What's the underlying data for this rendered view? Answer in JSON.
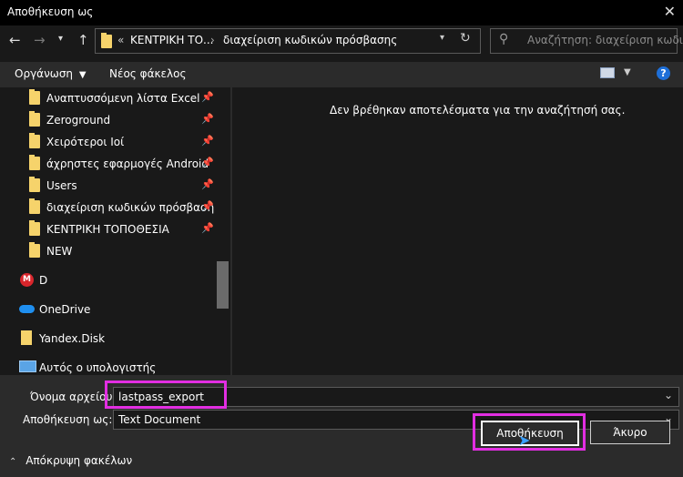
{
  "window": {
    "title": "Αποθήκευση ως"
  },
  "nav": {
    "breadcrumb_sep": "«",
    "crumb1": "ΚΕΝΤΡΙΚΗ ΤΟ...",
    "crumb2": "διαχείριση κωδικών πρόσβασης",
    "search_placeholder": "Αναζήτηση: διαχείριση κωδι..."
  },
  "toolbar": {
    "organize": "Οργάνωση",
    "new_folder": "Νέος φάκελος"
  },
  "sidebar": {
    "items": [
      {
        "label": "Αναπτυσσόμενη λίστα Excel",
        "icon": "folder-icon",
        "pinned": true
      },
      {
        "label": "Zeroground",
        "icon": "folder-icon",
        "pinned": true
      },
      {
        "label": "Χειρότεροι Ιοί",
        "icon": "folder-icon",
        "pinned": true
      },
      {
        "label": "άχρηστες εφαρμογές Android",
        "icon": "folder-icon",
        "pinned": true
      },
      {
        "label": "Users",
        "icon": "folder-icon",
        "pinned": true
      },
      {
        "label": "διαχείριση κωδικών πρόσβαση",
        "icon": "folder-icon",
        "pinned": true
      },
      {
        "label": "ΚΕΝΤΡΙΚΗ ΤΟΠΟΘΕΣΙΑ",
        "icon": "folder-icon",
        "pinned": true
      },
      {
        "label": "NEW",
        "icon": "folder-icon",
        "pinned": false
      }
    ],
    "drives": [
      {
        "label": "D",
        "icon": "mega-icon"
      },
      {
        "label": "OneDrive",
        "icon": "cloud-icon"
      },
      {
        "label": "Yandex.Disk",
        "icon": "yandex-disk-icon"
      },
      {
        "label": "Αυτός ο υπολογιστής",
        "icon": "computer-icon"
      }
    ]
  },
  "main": {
    "empty_message": "Δεν βρέθηκαν αποτελέσματα για την αναζήτησή σας."
  },
  "form": {
    "filename_label": "Όνομα αρχείου:",
    "filename_value": "lastpass_export",
    "savetype_label": "Αποθήκευση ως:",
    "savetype_value": "Text Document"
  },
  "footer": {
    "hide_folders": "Απόκρυψη φακέλων",
    "save_button": "Αποθήκευση",
    "cancel_button": "Άκυρο"
  },
  "colors": {
    "highlight": "#e22ee2",
    "folder": "#f6d36b",
    "help": "#1e6fd8"
  }
}
